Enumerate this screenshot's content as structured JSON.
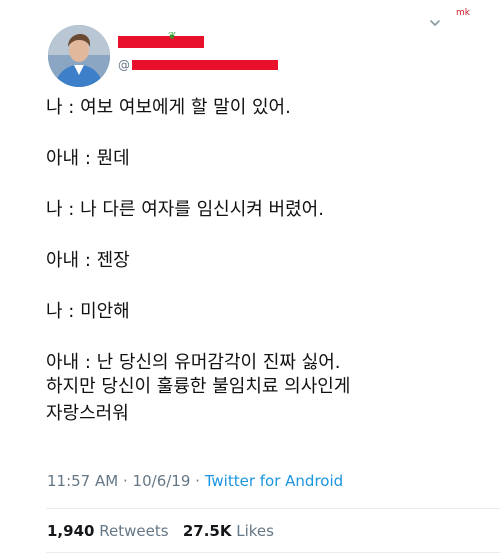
{
  "watermark": "mk",
  "author": {
    "handle_prefix": "@"
  },
  "tweet": {
    "lines": [
      "나 : 여보 여보에게 할 말이 있어.",
      "아내 : 뭔데",
      "나 : 나 다른 여자를 임신시켜 버렸어.",
      "아내 : 젠장",
      "나 : 미안해",
      "아내 : 난 당신의 유머감각이 진짜 싫어.",
      "하지만 당신이 훌륭한 불임치료 의사인게",
      "자랑스러워"
    ],
    "time": "11:57 AM",
    "separator": "·",
    "date": "10/6/19",
    "source": "Twitter for Android"
  },
  "stats": {
    "retweets_count": "1,940",
    "retweets_label": "Retweets",
    "likes_count": "27.5K",
    "likes_label": "Likes"
  }
}
